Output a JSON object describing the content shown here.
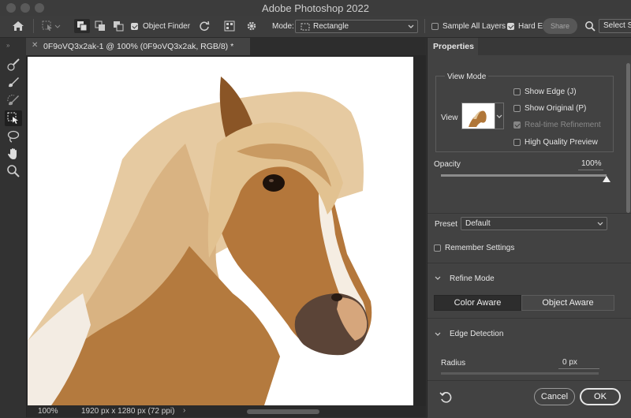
{
  "titlebar": {
    "title": "Adobe Photoshop 2022"
  },
  "optionsbar": {
    "object_finder": "Object Finder",
    "mode_label": "Mode:",
    "mode_value": "Rectangle",
    "sample_all_layers": "Sample All Layers",
    "hard_edge": "Hard E",
    "share_button": "Share",
    "select_subject": "Select S"
  },
  "document": {
    "tab_title": "0F9oVQ3x2ak-1 @ 100% (0F9oVQ3x2ak, RGB/8) *",
    "zoom": "100%",
    "info": "1920 px x 1280 px (72 ppi)"
  },
  "properties": {
    "tab_label": "Properties",
    "view_mode_title": "View Mode",
    "view_label": "View",
    "show_edge": "Show Edge (J)",
    "show_original": "Show Original (P)",
    "realtime_refinement": "Real-time Refinement",
    "high_quality_preview": "High Quality Preview",
    "opacity_label": "Opacity",
    "opacity_value": "100%",
    "opacity_fraction": 1.0,
    "preset_label": "Preset",
    "preset_value": "Default",
    "remember_settings": "Remember Settings",
    "refine_mode_title": "Refine Mode",
    "color_aware": "Color Aware",
    "object_aware": "Object Aware",
    "edge_detection_title": "Edge Detection",
    "radius_label": "Radius",
    "radius_value": "0 px",
    "cancel_button": "Cancel",
    "ok_button": "OK"
  },
  "colors": {
    "app_bg": "#323232",
    "panel_bg": "#424242",
    "canvas_bg": "#ffffff",
    "horse_brown": "#b0743a",
    "mane_blond": "#e8cfa9",
    "blaze_white": "#f4ece2"
  }
}
